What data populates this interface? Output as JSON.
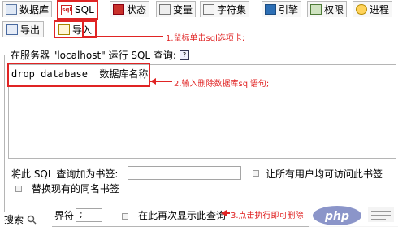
{
  "tabs": [
    {
      "label": "数据库",
      "icon": "database-icon"
    },
    {
      "label": "SQL",
      "icon": "sql-icon",
      "active": true
    },
    {
      "label": "状态",
      "icon": "status-icon"
    },
    {
      "label": "变量",
      "icon": "variables-icon"
    },
    {
      "label": "字符集",
      "icon": "charset-icon"
    },
    {
      "label": "引擎",
      "icon": "engine-icon"
    },
    {
      "label": "权限",
      "icon": "privileges-icon"
    },
    {
      "label": "进程",
      "icon": "processes-icon"
    }
  ],
  "subtabs": [
    {
      "label": "导出",
      "icon": "export-icon"
    },
    {
      "label": "导入",
      "icon": "import-icon",
      "active": true
    }
  ],
  "panel": {
    "legend": "在服务器 \"localhost\" 运行 SQL 查询:",
    "query": "drop database  数据库名称",
    "bookmark_label": "将此 SQL 查询加为书签:",
    "bookmark_value": "",
    "share_label": "让所有用户均可访问此书签",
    "replace_label": "替换现有的同名书签",
    "delimiter_label": "界符",
    "delimiter_value": ";",
    "show_again_label": "在此再次显示此查询"
  },
  "annotations": {
    "step1": "1.鼠标单击sql选项卡;",
    "step2": "2.输入删除数据库sql语句;",
    "step3": "3.点击执行即可删除"
  },
  "watermark": {
    "label": "搜索"
  },
  "colors": {
    "highlight": "#e02424",
    "border": "#b5b5b5"
  }
}
